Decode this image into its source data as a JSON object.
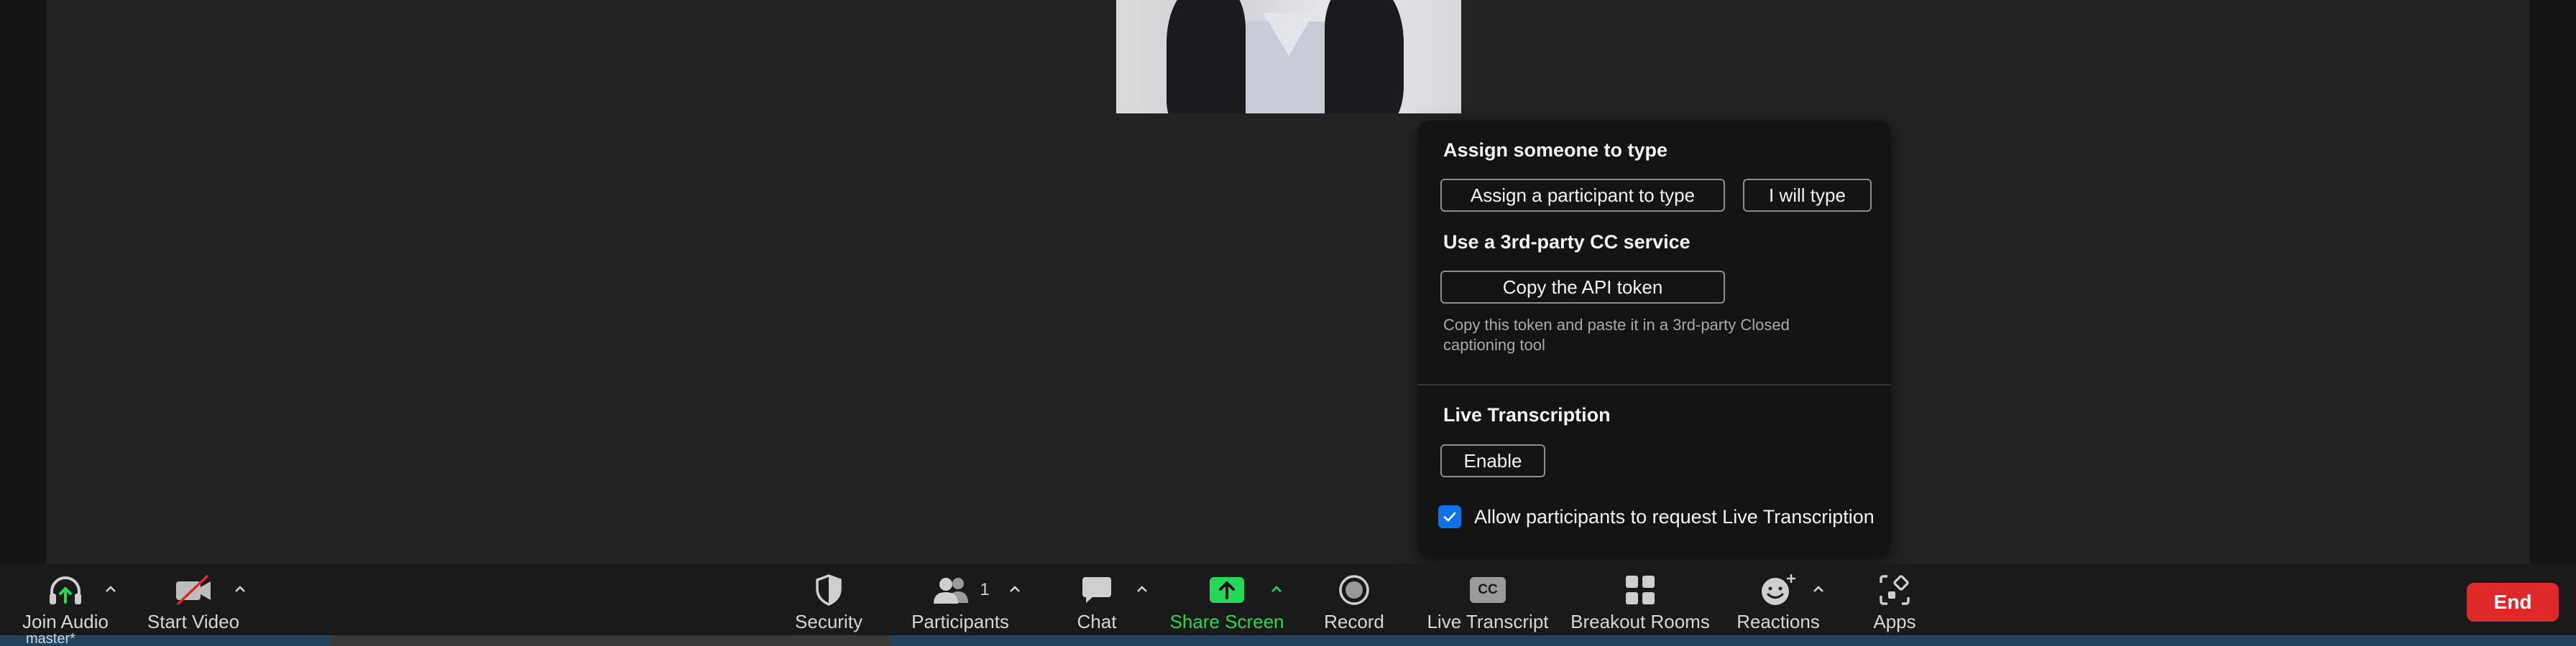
{
  "captions_popup": {
    "assign_section_title": "Assign someone to type",
    "assign_participant_label": "Assign a participant to type",
    "i_will_type_label": "I will type",
    "third_party_title": "Use a 3rd-party CC service",
    "copy_token_label": "Copy the API token",
    "copy_token_hint": "Copy this token and paste it in a 3rd-party Closed captioning tool",
    "live_transcription_title": "Live Transcription",
    "enable_label": "Enable",
    "allow_request_label": "Allow participants to request Live Transcription",
    "allow_request_checked": true
  },
  "toolbar": {
    "join_audio": "Join Audio",
    "start_video": "Start Video",
    "security": "Security",
    "participants": "Participants",
    "participants_count": "1",
    "chat": "Chat",
    "share_screen": "Share Screen",
    "record": "Record",
    "live_transcript": "Live Transcript",
    "live_transcript_badge": "CC",
    "breakout_rooms": "Breakout Rooms",
    "reactions": "Reactions",
    "apps": "Apps",
    "end": "End"
  },
  "taskbar": {
    "branch": "master*"
  },
  "colors": {
    "accent_blue": "#0e72ed",
    "share_green": "#23d959",
    "end_red": "#e02828"
  }
}
